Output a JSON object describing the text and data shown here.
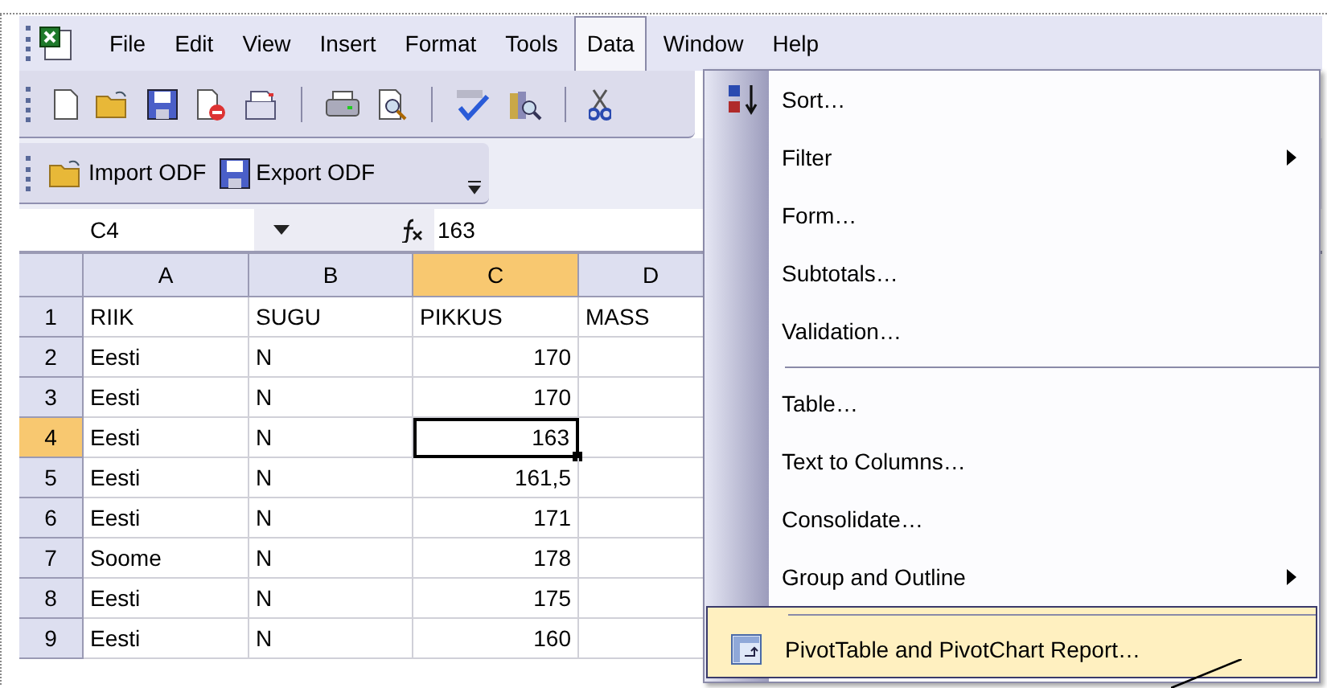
{
  "menu_bar": [
    {
      "label": "File",
      "selected": false
    },
    {
      "label": "Edit",
      "selected": false
    },
    {
      "label": "View",
      "selected": false
    },
    {
      "label": "Insert",
      "selected": false
    },
    {
      "label": "Format",
      "selected": false
    },
    {
      "label": "Tools",
      "selected": false
    },
    {
      "label": "Data",
      "selected": true
    },
    {
      "label": "Window",
      "selected": false
    },
    {
      "label": "Help",
      "selected": false
    }
  ],
  "odf_toolbar": [
    {
      "label": "Import ODF",
      "kind": "open"
    },
    {
      "label": "Export ODF",
      "kind": "save"
    }
  ],
  "formula_bar": {
    "name_box": "C4",
    "value": "163"
  },
  "sheet": {
    "columns": [
      {
        "label": "A",
        "selected": false
      },
      {
        "label": "B",
        "selected": false
      },
      {
        "label": "C",
        "selected": true
      },
      {
        "label": "D",
        "selected": false
      }
    ],
    "rows": [
      {
        "number": "1",
        "selected": false,
        "cells": [
          {
            "text": "RIIK",
            "kind": "text",
            "selected": false
          },
          {
            "text": "SUGU",
            "kind": "text",
            "selected": false
          },
          {
            "text": "PIKKUS",
            "kind": "text",
            "selected": false
          },
          {
            "text": "MASS",
            "kind": "text",
            "selected": false
          }
        ]
      },
      {
        "number": "2",
        "selected": false,
        "cells": [
          {
            "text": "Eesti",
            "kind": "text",
            "selected": false
          },
          {
            "text": "N",
            "kind": "text",
            "selected": false
          },
          {
            "text": "170",
            "kind": "number",
            "selected": false
          }
        ]
      },
      {
        "number": "3",
        "selected": false,
        "cells": [
          {
            "text": "Eesti",
            "kind": "text",
            "selected": false
          },
          {
            "text": "N",
            "kind": "text",
            "selected": false
          },
          {
            "text": "170",
            "kind": "number",
            "selected": false
          }
        ]
      },
      {
        "number": "4",
        "selected": true,
        "cells": [
          {
            "text": "Eesti",
            "kind": "text",
            "selected": false
          },
          {
            "text": "N",
            "kind": "text",
            "selected": false
          },
          {
            "text": "163",
            "kind": "number",
            "selected": true
          }
        ]
      },
      {
        "number": "5",
        "selected": false,
        "cells": [
          {
            "text": "Eesti",
            "kind": "text",
            "selected": false
          },
          {
            "text": "N",
            "kind": "text",
            "selected": false
          },
          {
            "text": "161,5",
            "kind": "number",
            "selected": false
          }
        ]
      },
      {
        "number": "6",
        "selected": false,
        "cells": [
          {
            "text": "Eesti",
            "kind": "text",
            "selected": false
          },
          {
            "text": "N",
            "kind": "text",
            "selected": false
          },
          {
            "text": "171",
            "kind": "number",
            "selected": false
          }
        ]
      },
      {
        "number": "7",
        "selected": false,
        "cells": [
          {
            "text": "Soome",
            "kind": "text",
            "selected": false
          },
          {
            "text": "N",
            "kind": "text",
            "selected": false
          },
          {
            "text": "178",
            "kind": "number",
            "selected": false
          }
        ]
      },
      {
        "number": "8",
        "selected": false,
        "cells": [
          {
            "text": "Eesti",
            "kind": "text",
            "selected": false
          },
          {
            "text": "N",
            "kind": "text",
            "selected": false
          },
          {
            "text": "175",
            "kind": "number",
            "selected": false
          }
        ]
      },
      {
        "number": "9",
        "selected": false,
        "cells": [
          {
            "text": "Eesti",
            "kind": "text",
            "selected": false
          },
          {
            "text": "N",
            "kind": "text",
            "selected": false
          },
          {
            "text": "160",
            "kind": "number",
            "selected": false
          }
        ]
      }
    ]
  },
  "data_menu": [
    {
      "label": "Sort…",
      "kind": "sort",
      "separator_before": false,
      "selected": false
    },
    {
      "label": "Filter",
      "kind": "submenu",
      "separator_before": false,
      "selected": false
    },
    {
      "label": "Form…",
      "kind": "plain",
      "separator_before": false,
      "selected": false
    },
    {
      "label": "Subtotals…",
      "kind": "plain",
      "separator_before": false,
      "selected": false
    },
    {
      "label": "Validation…",
      "kind": "plain",
      "separator_before": false,
      "selected": false
    },
    {
      "label": "Table…",
      "kind": "plain",
      "separator_before": true,
      "selected": false
    },
    {
      "label": "Text to Columns…",
      "kind": "plain",
      "separator_before": false,
      "selected": false
    },
    {
      "label": "Consolidate…",
      "kind": "plain",
      "separator_before": false,
      "selected": false
    },
    {
      "label": "Group and Outline",
      "kind": "submenu",
      "separator_before": false,
      "selected": false
    },
    {
      "label": "PivotTable and PivotChart Report…",
      "kind": "pivot",
      "separator_before": true,
      "selected": true
    }
  ]
}
